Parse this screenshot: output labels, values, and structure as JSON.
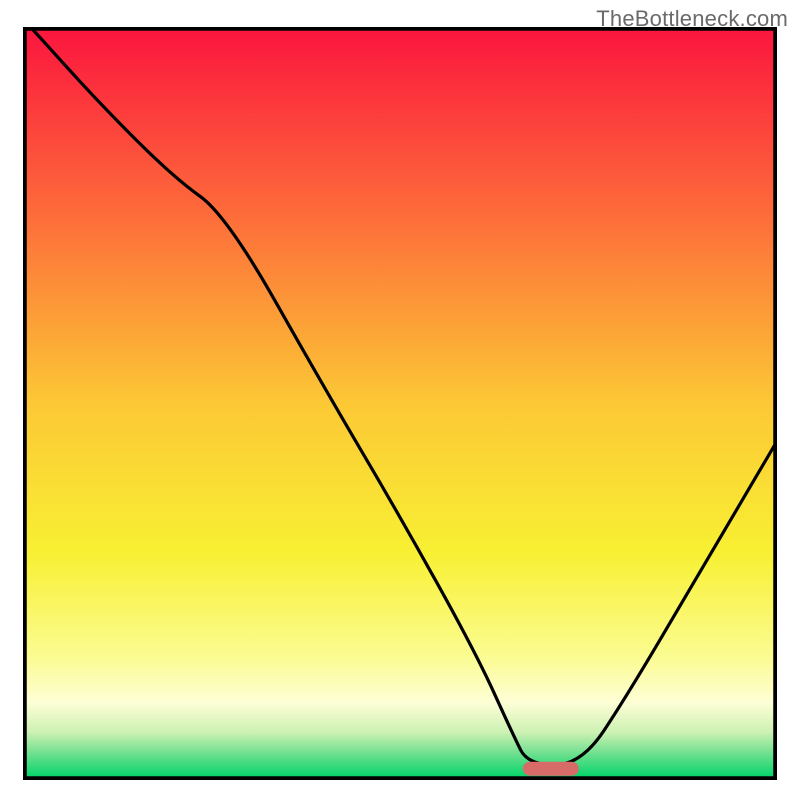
{
  "watermark": "TheBottleneck.com",
  "chart_data": {
    "type": "line",
    "title": "",
    "xlabel": "",
    "ylabel": "",
    "xlim": [
      0,
      100
    ],
    "ylim": [
      0,
      100
    ],
    "grid": false,
    "legend": false,
    "description": "Bottleneck curve overlaid on a vertical color gradient (red at top through yellow to green at bottom). The black curve descends from top-left, bends near x≈27 y≈75, dips to a valley around x≈70 y≈2 where a small red pill marker sits, then rises to about y≈45 at the right edge.",
    "gradient_stops": [
      {
        "offset": 0.0,
        "color": "#fb163e"
      },
      {
        "offset": 0.25,
        "color": "#fd6d3a"
      },
      {
        "offset": 0.5,
        "color": "#fcc835"
      },
      {
        "offset": 0.7,
        "color": "#f8f033"
      },
      {
        "offset": 0.84,
        "color": "#fbfc92"
      },
      {
        "offset": 0.9,
        "color": "#fefed6"
      },
      {
        "offset": 0.94,
        "color": "#cdf1b3"
      },
      {
        "offset": 0.97,
        "color": "#6adf8d"
      },
      {
        "offset": 1.0,
        "color": "#05d46b"
      }
    ],
    "series": [
      {
        "name": "bottleneck-curve",
        "x": [
          1,
          10,
          20,
          27,
          40,
          50,
          60,
          65,
          67,
          74,
          80,
          90,
          100
        ],
        "y": [
          100,
          90,
          80,
          75,
          52,
          35,
          17,
          6,
          2,
          2,
          11,
          28,
          45
        ]
      }
    ],
    "marker": {
      "x": 70,
      "y": 1.5,
      "color": "#d76b68"
    }
  }
}
